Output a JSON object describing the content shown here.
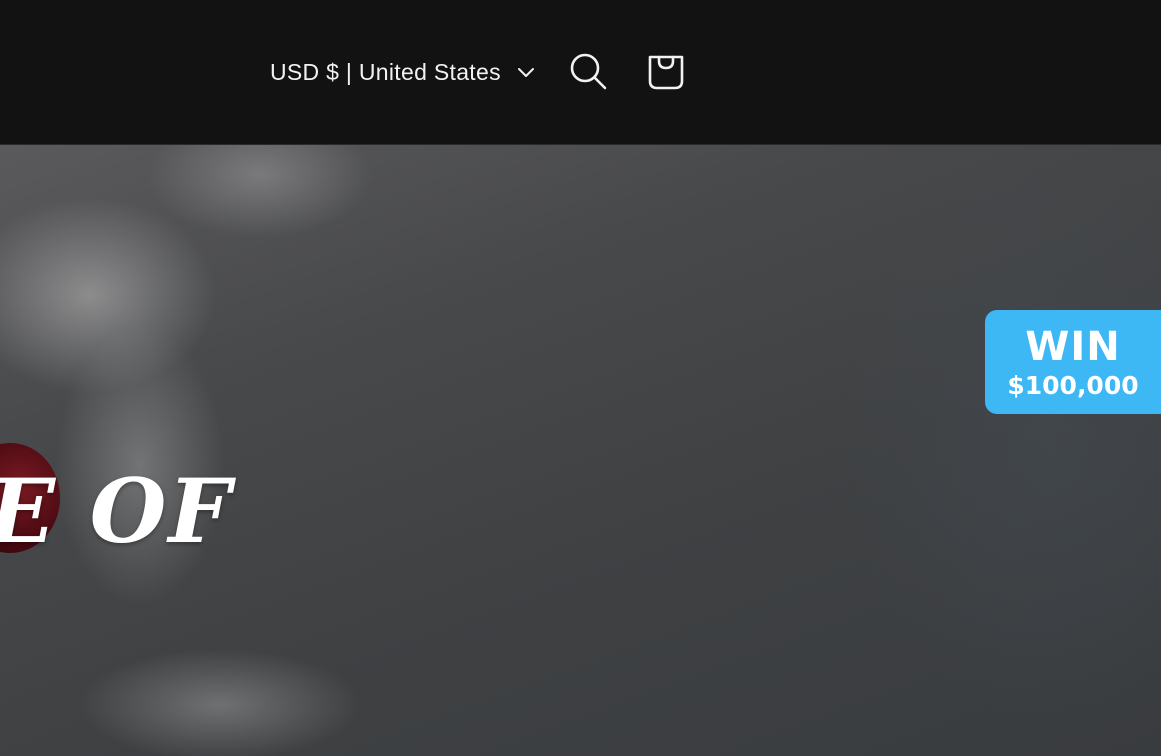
{
  "header": {
    "country_selector": {
      "label": "USD $ | United States",
      "icon": "chevron-down-icon"
    },
    "search_icon": "search-icon",
    "cart_icon": "cart-icon"
  },
  "hero": {
    "headline_fragment": "E OF"
  },
  "promo_badge": {
    "title": "WIN",
    "amount": "$100,000",
    "color": "#3eb7f5"
  },
  "colors": {
    "header_bg": "#121212",
    "header_text": "#f2f2f2"
  }
}
